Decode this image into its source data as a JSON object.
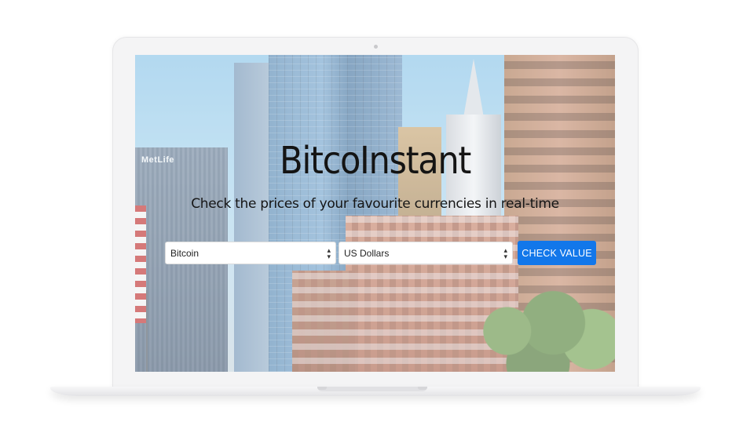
{
  "app": {
    "title": "BitcoInstant",
    "subtitle": "Check the prices of your favourite currencies in real-time"
  },
  "background": {
    "building_sign": "MetLife"
  },
  "form": {
    "crypto_select": {
      "selected": "Bitcoin"
    },
    "fiat_select": {
      "selected": "US Dollars"
    },
    "submit_label": "CHECK VALUE"
  },
  "icons": {
    "select_arrows": "up-down-arrows-icon",
    "camera": "camera-dot-icon"
  },
  "colors": {
    "accent": "#1277ea",
    "title_text": "#141414",
    "laptop_frame": "#f4f4f5"
  }
}
